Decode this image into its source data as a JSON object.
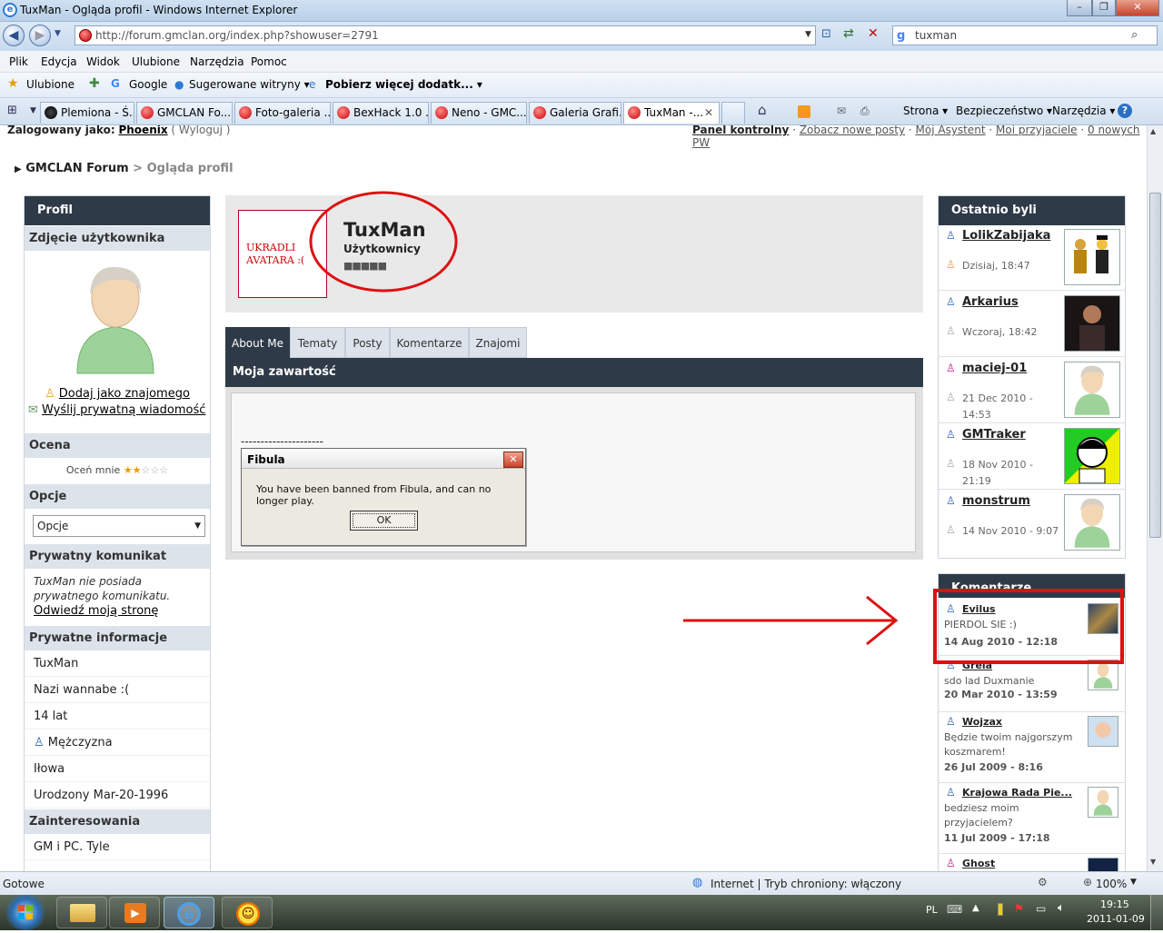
{
  "window": {
    "title": "TuxMan - Ogląda profil - Windows Internet Explorer"
  },
  "address": {
    "url": "http://forum.gmclan.org/index.php?showuser=2791",
    "search": "tuxman"
  },
  "menu": [
    "Plik",
    "Edycja",
    "Widok",
    "Ulubione",
    "Narzędzia",
    "Pomoc"
  ],
  "favorites": {
    "label": "Ulubione",
    "items": [
      "Google",
      "Sugerowane witryny ▾",
      "Pobierz więcej dodatk... ▾"
    ]
  },
  "tabs": [
    "Plemiona - Ś...",
    "GMCLAN Fo...",
    "Foto-galeria ...",
    "BexHack 1.0 ...",
    "Neno - GMC...",
    "Galeria Grafi...",
    "TuxMan -..."
  ],
  "toolbar": {
    "strona": "Strona ▾",
    "bezpieczenstwo": "Bezpieczeństwo ▾",
    "narzedzia": "Narzędzia ▾"
  },
  "top": {
    "logged_prefix": "Zalogowany jako:",
    "logged_user": "Phoenix",
    "logout": "( Wyloguj )",
    "links": [
      "Panel kontrolny",
      "Zobacz nowe posty",
      "Mój Asystent",
      "Moi przyjaciele",
      "0 nowych PW"
    ]
  },
  "breadcrumb": {
    "home": "GMCLAN Forum",
    "sep": " > ",
    "current": "Ogląda profil"
  },
  "left": {
    "profile_title": "Profil",
    "photo_title": "Zdjęcie użytkownika",
    "add_friend": "Dodaj jako znajomego",
    "send_pm": "Wyślij prywatną wiadomość",
    "rating_title": "Ocena",
    "rate_label": "Oceń mnie",
    "rating": "2/5",
    "options_title": "Opcje",
    "options_select": "Opcje",
    "private_msg_title": "Prywatny komunikat",
    "private_msg_text": "TuxMan nie posiada prywatnego komunikatu.",
    "visit_page": "Odwiedź moją stronę",
    "info_title": "Prywatne informacje",
    "info": [
      "TuxMan",
      "Nazi wannabe :(",
      "14 lat",
      "Mężczyzna",
      "Iłowa",
      "Urodzony Mar-20-1996"
    ],
    "interests_title": "Zainteresowania",
    "interests": "GM i PC. Tyle"
  },
  "profile": {
    "avatar_text": "UKRADLI AVATARA :(",
    "name": "TuxMan",
    "group": "Użytkownicy",
    "rank": "■■■■■"
  },
  "profile_tabs": [
    "About Me",
    "Tematy",
    "Posty",
    "Komentarze",
    "Znajomi"
  ],
  "content": {
    "title": "Moja zawartość",
    "separator": "---------------------",
    "dialog_title": "Fibula",
    "dialog_message": "You have been banned from Fibula, and can no longer play.",
    "dialog_ok": "OK"
  },
  "recent": {
    "title": "Ostatnio byli",
    "visitors": [
      {
        "name": "LolikZabijaka",
        "time": "Dzisiaj, 18:47"
      },
      {
        "name": "Arkarius",
        "time": "Wczoraj, 18:42"
      },
      {
        "name": "maciej-01",
        "time": "21 Dec 2010 - 14:53"
      },
      {
        "name": "GMTraker",
        "time": "18 Nov 2010 - 21:19"
      },
      {
        "name": "monstrum",
        "time": "14 Nov 2010 - 9:07"
      }
    ]
  },
  "comments": {
    "title": "Komentarze",
    "items": [
      {
        "name": "Evilus",
        "text": "PIERDOL SIE :)",
        "date": "14 Aug 2010 - 12:18"
      },
      {
        "name": "Grela",
        "text": "sdo lad Duxmanie",
        "date": "20 Mar 2010 - 13:59"
      },
      {
        "name": "Wojzax",
        "text": "Będzie twoim najgorszym koszmarem!",
        "date": "26 Jul 2009 - 8:16"
      },
      {
        "name": "Krajowa Rada Pie...",
        "text": "bedziesz moim przyjacielem?",
        "date": "11 Jul 2009 - 17:18"
      },
      {
        "name": "Ghost",
        "text": "",
        "date": ""
      }
    ]
  },
  "status": {
    "left": "Gotowe",
    "zone": "Internet | Tryb chroniony: włączony",
    "zoom": "100%"
  },
  "taskbar": {
    "lang": "PL",
    "time": "19:15",
    "date": "2011-01-09"
  },
  "colors": {
    "dark_header": "#2e3a48",
    "light_header": "#dde3ea",
    "annotation_red": "#dd1111"
  }
}
